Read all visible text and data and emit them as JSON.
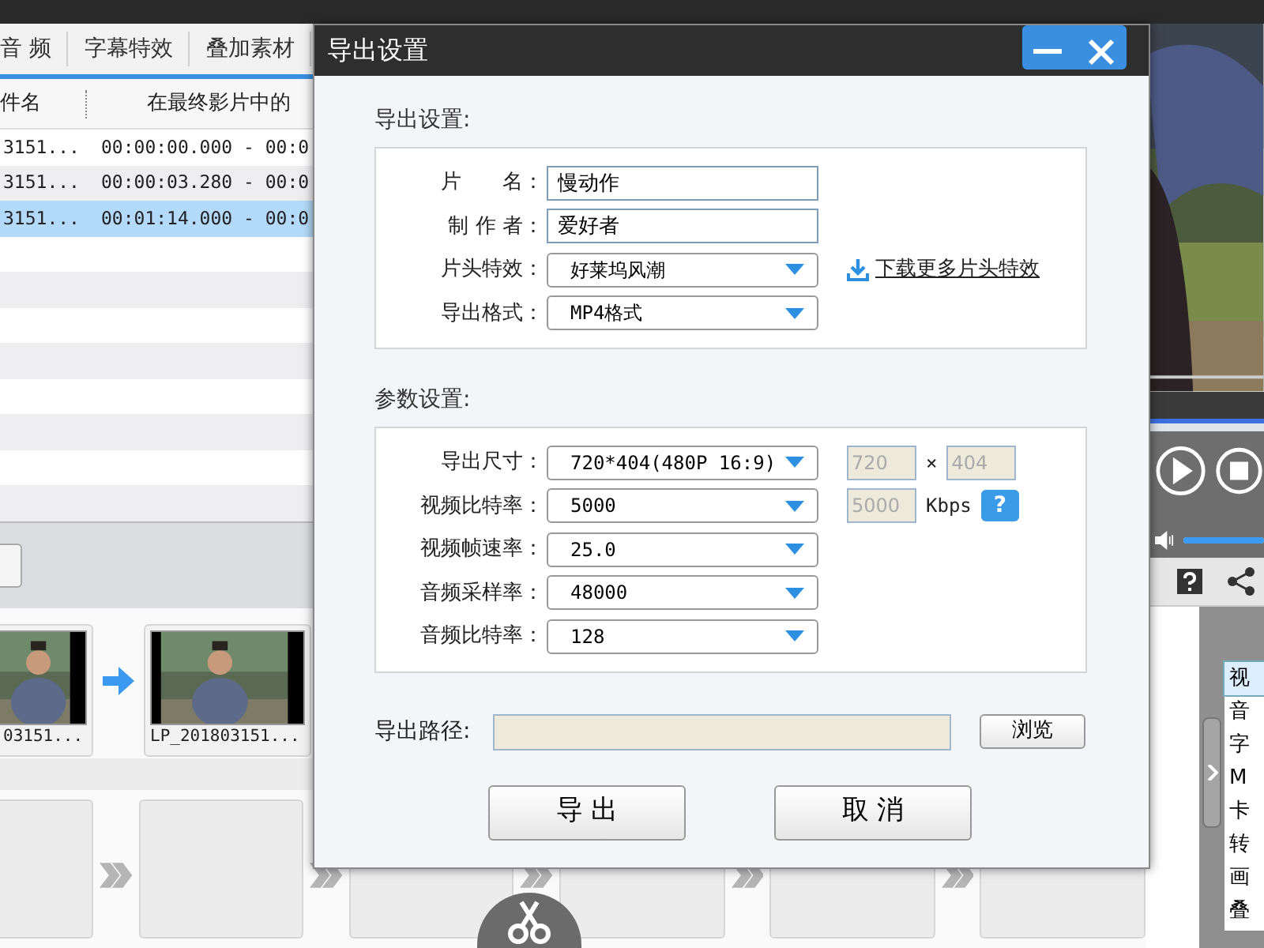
{
  "app": {
    "tabs": [
      {
        "label": "音 频"
      },
      {
        "label": "字幕特效"
      },
      {
        "label": "叠加素材"
      }
    ],
    "table": {
      "columns": [
        "件名",
        "在最终影片中的"
      ],
      "rows": [
        {
          "cells": [
            "3151...",
            "00:00:00.000 - 00:0"
          ],
          "selected": false
        },
        {
          "cells": [
            "3151...",
            "00:00:03.280 - 00:0"
          ],
          "selected": false
        },
        {
          "cells": [
            "3151...",
            "00:01:14.000 - 00:0"
          ],
          "selected": true
        }
      ]
    },
    "clips": [
      {
        "label": "03151..."
      },
      {
        "label": "LP_201803151..."
      }
    ],
    "volume": {
      "level": 1
    },
    "side_list": [
      {
        "label": "视",
        "selected": true
      },
      {
        "label": "音",
        "selected": false
      },
      {
        "label": "字",
        "selected": false
      },
      {
        "label": "M",
        "selected": false
      },
      {
        "label": "卡",
        "selected": false
      },
      {
        "label": "转",
        "selected": false
      },
      {
        "label": "画",
        "selected": false
      },
      {
        "label": "叠",
        "selected": false
      }
    ]
  },
  "dialog": {
    "title": "导出设置",
    "sections": [
      {
        "title": "导出设置:",
        "rows": [
          {
            "kind": "text",
            "label": "片　　名：",
            "value": "慢动作"
          },
          {
            "kind": "text",
            "label": "制 作 者：",
            "value": "爱好者"
          },
          {
            "kind": "select",
            "label": "片头特效：",
            "value": "好莱坞风潮",
            "link": "下载更多片头特效"
          },
          {
            "kind": "select",
            "label": "导出格式：",
            "value": "MP4格式"
          }
        ]
      },
      {
        "title": "参数设置:",
        "rows": [
          {
            "kind": "select",
            "label": "导出尺寸：",
            "value": "720*404(480P 16:9)",
            "extras": [
              {
                "kind": "field",
                "value": "720",
                "disabled": true
              },
              {
                "kind": "sign",
                "value": "×"
              },
              {
                "kind": "field",
                "value": "404",
                "disabled": true
              }
            ]
          },
          {
            "kind": "select",
            "label": "视频比特率：",
            "value": "5000",
            "extras": [
              {
                "kind": "field",
                "value": "5000",
                "disabled": true
              },
              {
                "kind": "unit",
                "value": "Kbps"
              },
              {
                "kind": "help",
                "value": "?"
              }
            ]
          },
          {
            "kind": "select",
            "label": "视频帧速率：",
            "value": "25.0"
          },
          {
            "kind": "select",
            "label": "音频采样率：",
            "value": "48000"
          },
          {
            "kind": "select",
            "label": "音频比特率：",
            "value": "128"
          }
        ]
      }
    ],
    "path": {
      "label": "导出路径:",
      "browse": "浏览"
    },
    "buttons": [
      "导 出",
      "取 消"
    ]
  }
}
